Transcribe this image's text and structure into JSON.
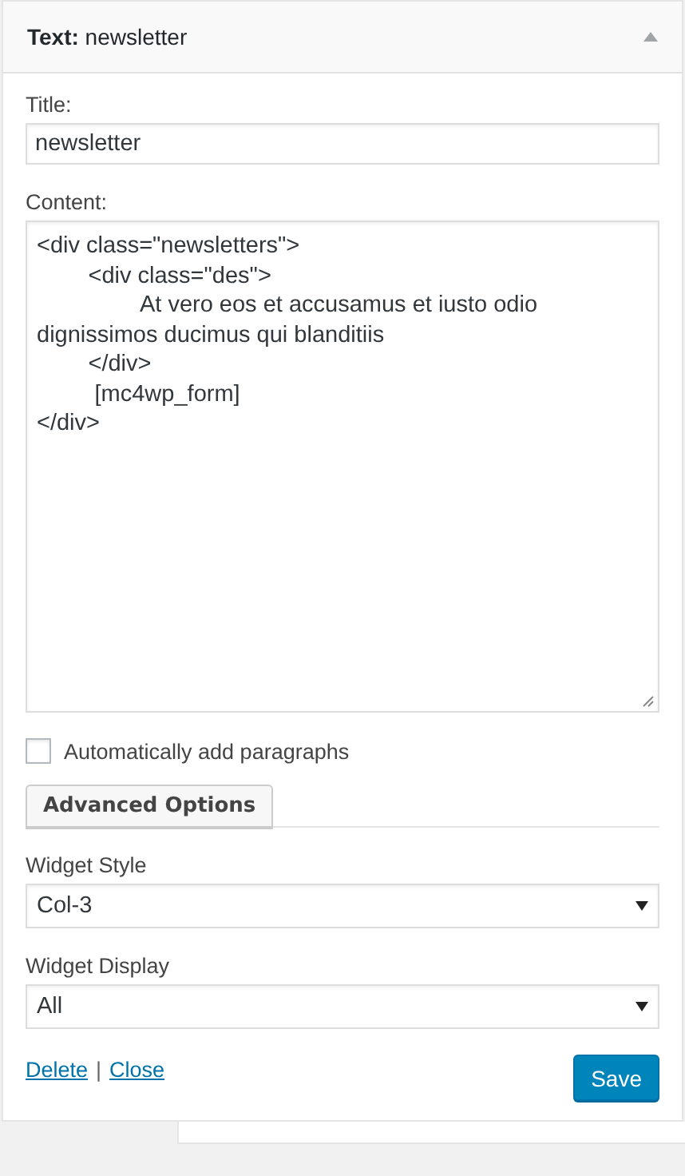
{
  "widget": {
    "title": "**Text:** newsletter",
    "expanded": true
  },
  "title_field": {
    "label": "Title:",
    "value": "newsletter"
  },
  "content_field": {
    "label": "Content:",
    "value": "<div class=\"newsletters\">\n\t<div class=\"des\">\n\t\tAt vero eos et accusamus et iusto odio dignissimos ducimus qui blanditiis\n\t</div>\n\t [mc4wp_form]\n</div>"
  },
  "auto_paragraphs": {
    "label": "Automatically add paragraphs",
    "checked": false
  },
  "advanced_button": "Advanced Options",
  "selects": [
    {
      "label": "Widget Style",
      "value": "Col-3"
    },
    {
      "label": "Widget Display",
      "value": "All"
    }
  ],
  "links": [
    "Delete",
    "Close"
  ],
  "link_separator": "|",
  "save_button": "Save"
}
